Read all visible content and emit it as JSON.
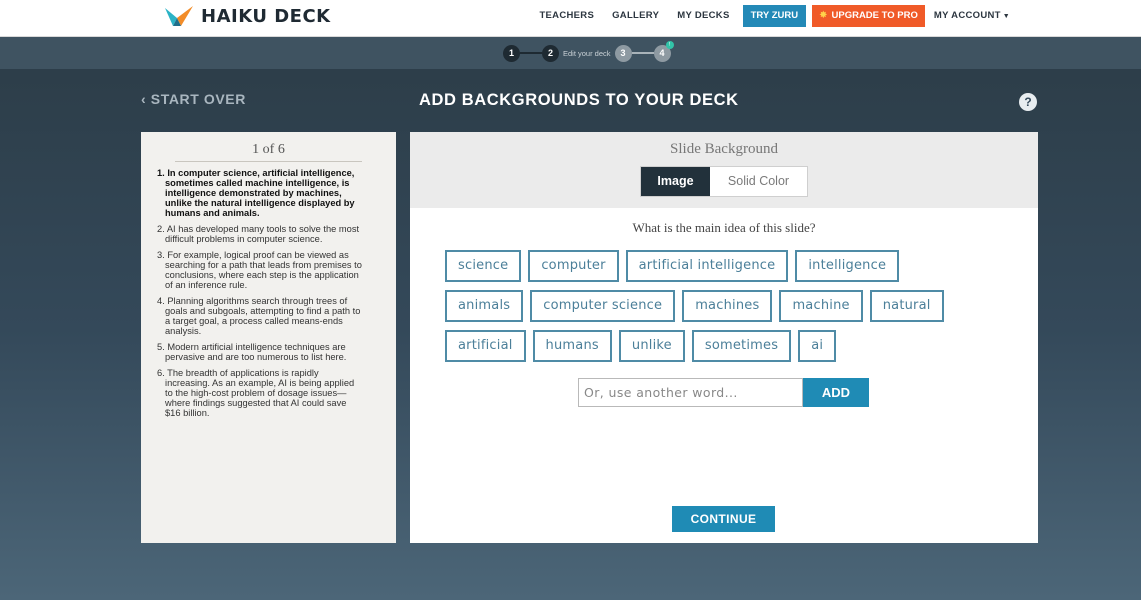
{
  "brand": {
    "name": "HAIKU DECK"
  },
  "nav": {
    "items": [
      "TEACHERS",
      "GALLERY",
      "MY DECKS"
    ],
    "try": "TRY ZURU",
    "upgrade": "UPGRADE TO PRO",
    "account": "MY ACCOUNT"
  },
  "stepper": {
    "steps": [
      "1",
      "2",
      "3",
      "4"
    ],
    "current_label": "Edit your deck",
    "badge": "!"
  },
  "header": {
    "start_over": "START OVER",
    "title": "ADD BACKGROUNDS TO YOUR DECK",
    "help": "?"
  },
  "slides": {
    "count": "1 of 6",
    "items": [
      "1. In computer science, artificial intelligence, sometimes called machine intelligence, is intelligence demonstrated by machines, unlike the natural intelligence displayed by humans and animals.",
      "2. AI has developed many tools to solve the most difficult problems in computer science.",
      "3. For example, logical proof can be viewed as searching for a path that leads from premises to conclusions, where each step is the application of an inference rule.",
      "4. Planning algorithms search through trees of goals and subgoals, attempting to find a path to a target goal, a process called means-ends analysis.",
      "5. Modern artificial intelligence techniques are pervasive and are too numerous to list here.",
      "6. The breadth of applications is rapidly increasing. As an example, AI is being applied to the high-cost problem of dosage issues—where findings suggested that AI could save $16 billion."
    ]
  },
  "background": {
    "title": "Slide Background",
    "toggle": {
      "image": "Image",
      "solid": "Solid Color"
    },
    "question": "What is the main idea of this slide?",
    "keywords": [
      [
        "science",
        "computer",
        "artificial intelligence",
        "intelligence"
      ],
      [
        "animals",
        "computer science",
        "machines",
        "machine",
        "natural"
      ],
      [
        "artificial",
        "humans",
        "unlike",
        "sometimes",
        "ai"
      ]
    ],
    "input_placeholder": "Or, use another word...",
    "add_label": "ADD",
    "continue_label": "CONTINUE"
  },
  "colors": {
    "accent": "#1f8bb5",
    "upgrade": "#f05a28",
    "chip_border": "#4f8ba6",
    "dark": "#22313b"
  }
}
